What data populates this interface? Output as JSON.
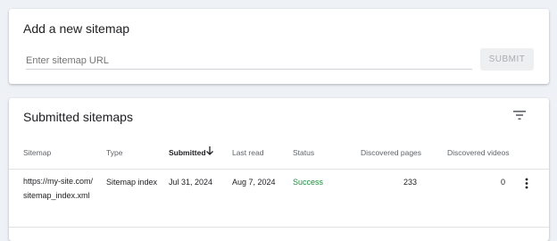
{
  "add_sitemap": {
    "title": "Add a new sitemap",
    "input_placeholder": "Enter sitemap URL",
    "input_value": "",
    "submit_label": "SUBMIT"
  },
  "submitted": {
    "title": "Submitted sitemaps",
    "filter_icon": "filter-list-icon",
    "columns": {
      "sitemap": "Sitemap",
      "type": "Type",
      "submitted": "Submitted",
      "last_read": "Last read",
      "status": "Status",
      "discovered_pages": "Discovered pages",
      "discovered_videos": "Discovered videos"
    },
    "sort": {
      "column": "submitted",
      "direction": "descending",
      "icon": "arrow-down-icon"
    },
    "rows": [
      {
        "sitemap": "https://my-site.com/sitemap_index.xml",
        "type": "Sitemap index",
        "submitted": "Jul 31, 2024",
        "last_read": "Aug 7, 2024",
        "status": "Success",
        "discovered_pages": "233",
        "discovered_videos": "0",
        "menu_icon": "more-vert-icon"
      }
    ]
  },
  "colors": {
    "background": "#eef1f5",
    "status_success": "#1e8e3e",
    "submit_disabled_bg": "#eeeff0",
    "submit_disabled_text": "#a9acb0"
  }
}
